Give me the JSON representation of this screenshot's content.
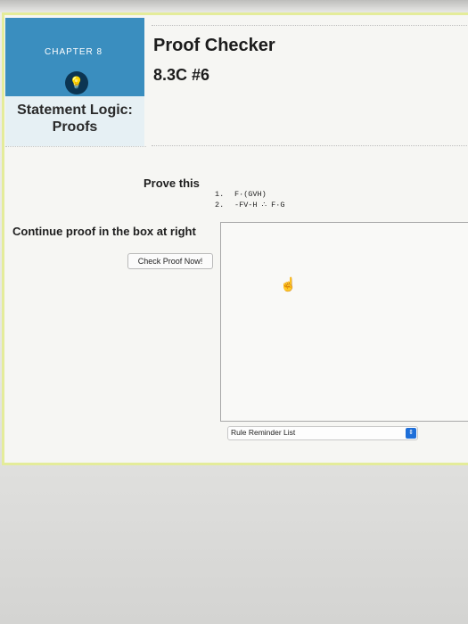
{
  "chapter": {
    "label": "CHAPTER 8",
    "icon": "lightbulb-icon",
    "title": "Statement Logic: Proofs"
  },
  "header": {
    "title": "Proof Checker",
    "subtitle": "8.3C #6"
  },
  "prove": {
    "label": "Prove this",
    "premises": [
      {
        "num": "1.",
        "text": "F·(GVH)"
      },
      {
        "num": "2.",
        "text": "-FV-H ∴ F·G"
      }
    ]
  },
  "instructions": "Continue proof in the box at right",
  "check_button": "Check Proof Now!",
  "proof_input": "",
  "rule_reminder": "Rule Reminder List",
  "colors": {
    "accent_border": "#e4ec9a",
    "chapter_blue": "#3a8ebf",
    "select_blue": "#1e6fd9"
  }
}
